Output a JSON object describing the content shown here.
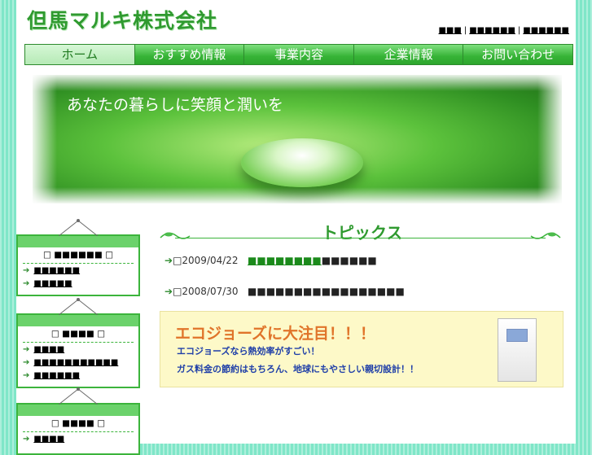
{
  "site": {
    "logo": "但馬マルキ株式会社"
  },
  "toplinks": [
    {
      "label": "■■■"
    },
    {
      "label": "■■■■■■"
    },
    {
      "label": "■■■■■■"
    }
  ],
  "nav": [
    {
      "label": "ホーム"
    },
    {
      "label": "おすすめ情報"
    },
    {
      "label": "事業内容"
    },
    {
      "label": "企業情報"
    },
    {
      "label": "お問い合わせ"
    }
  ],
  "hero": {
    "tagline": "あなたの暮らしに笑顔と潤いを"
  },
  "sidebar": [
    {
      "title": "□ ■■■■■■ □",
      "items": [
        "■■■■■■",
        "■■■■■"
      ]
    },
    {
      "title": "□ ■■■■ □",
      "items": [
        "■■■■",
        "■■■■■■■■■■■",
        "■■■■■■"
      ]
    },
    {
      "title": "□ ■■■■ □",
      "items": [
        "■■■■"
      ]
    }
  ],
  "topics": {
    "title": "トピックス",
    "items": [
      {
        "date": "2009/04/22",
        "link": "■■■■■■■■",
        "text": "■■■■■■"
      },
      {
        "date": "2008/07/30",
        "link": "",
        "text": "■■■■■■■■■■■■■■■■■"
      }
    ]
  },
  "banner": {
    "headline": "エコジョーズに大注目！！！",
    "line1": "エコジョーズなら熱効率がすごい！",
    "line2": "ガス料金の節約はもちろん、地球にもやさしい親切設計！！"
  },
  "colors": {
    "brand_green": "#2f9a2f",
    "nav_green": "#36b336",
    "page_bg": "#7fe6c8",
    "banner_bg": "#fdf9c8"
  }
}
